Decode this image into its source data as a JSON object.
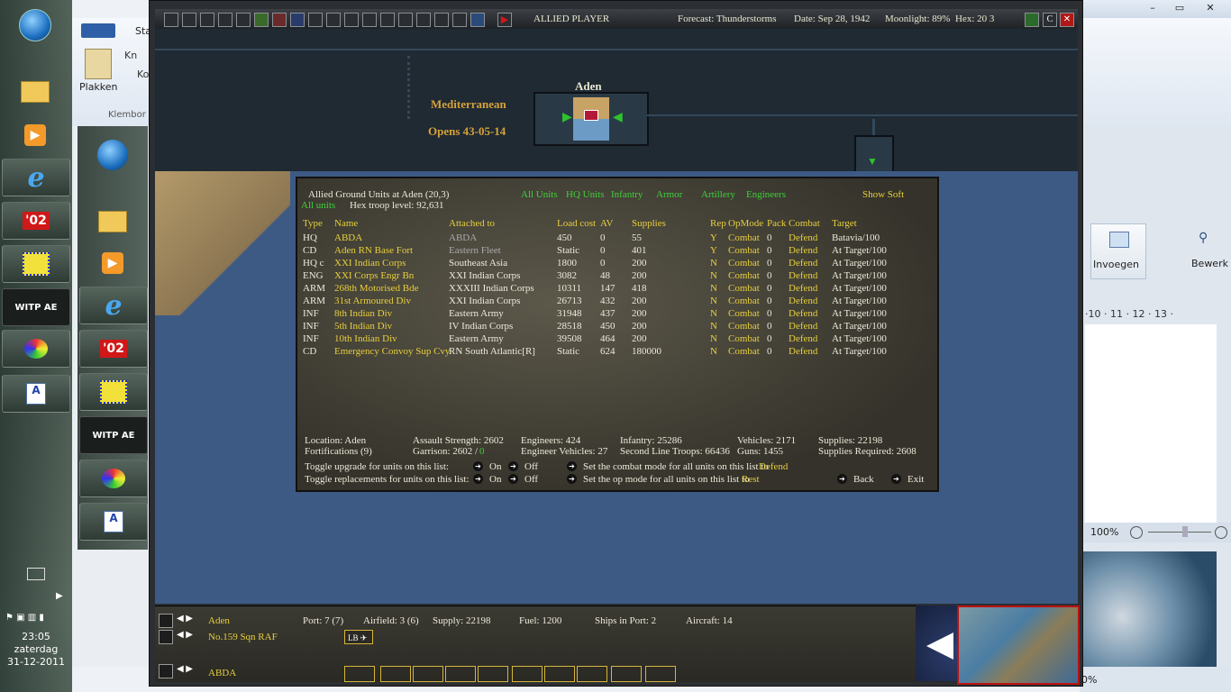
{
  "taskbar": {
    "time": "23:05",
    "day": "zaterdag",
    "date": "31-12-2011",
    "apps": [
      "start-orb",
      "folder",
      "media-player",
      "internet-explorer",
      "o2",
      "color-pen",
      "witp-ae",
      "paint",
      "wordpad"
    ],
    "witp_label": "WITP AE",
    "o2_label": "'02"
  },
  "word": {
    "clipboard_paste": "Plakken",
    "clipboard_group": "Klembor",
    "tab_partial": "Sta",
    "cut_partial": "Kn",
    "copy_partial": "Ko",
    "insert_label": "Invoegen",
    "edit_label": "Bewerk",
    "ruler": "·10 · 11 · 12 · 13 ·",
    "zoom": "100%",
    "zoom_bottom": "0%"
  },
  "game": {
    "player": "ALLIED PLAYER",
    "forecast": "Forecast: Thunderstorms",
    "date": "Date: Sep 28, 1942",
    "moonlight": "Moonlight: 89%",
    "hex": "Hex: 20 3",
    "map": {
      "base_name": "Aden",
      "mediterranean": "Mediterranean",
      "opens": "Opens 43-05-14"
    },
    "dialog": {
      "title": "Allied Ground Units at Aden  (20,3)",
      "all_units_label": "All units",
      "hex_troop": "Hex troop level: 92,631",
      "filters": [
        "All Units",
        "HQ Units",
        "Infantry",
        "Armor",
        "Artillery",
        "Engineers"
      ],
      "show_soft": "Show Soft",
      "columns": [
        "Type",
        "Name",
        "Attached to",
        "Load cost",
        "AV",
        "Supplies",
        "Rep",
        "OpMode",
        "Pack",
        "Combat",
        "Target"
      ],
      "rows": [
        [
          "HQ",
          "ABDA",
          "ABDA",
          "450",
          "0",
          "55",
          "Y",
          "Combat",
          "0",
          "Defend",
          "Batavia/100"
        ],
        [
          "CD",
          "Aden RN Base Fort",
          "Eastern Fleet",
          "Static",
          "0",
          "401",
          "Y",
          "Combat",
          "0",
          "Defend",
          "At Target/100"
        ],
        [
          "HQ c",
          "XXI Indian Corps",
          "Southeast Asia",
          "1800",
          "0",
          "200",
          "N",
          "Combat",
          "0",
          "Defend",
          "At Target/100"
        ],
        [
          "ENG",
          "XXI Corps Engr Bn",
          "XXI Indian Corps",
          "3082",
          "48",
          "200",
          "N",
          "Combat",
          "0",
          "Defend",
          "At Target/100"
        ],
        [
          "ARM",
          "268th Motorised Bde",
          "XXXIII Indian Corps",
          "10311",
          "147",
          "418",
          "N",
          "Combat",
          "0",
          "Defend",
          "At Target/100"
        ],
        [
          "ARM",
          "31st Armoured Div",
          "XXI Indian Corps",
          "26713",
          "432",
          "200",
          "N",
          "Combat",
          "0",
          "Defend",
          "At Target/100"
        ],
        [
          "INF",
          "8th Indian Div",
          "Eastern Army",
          "31948",
          "437",
          "200",
          "N",
          "Combat",
          "0",
          "Defend",
          "At Target/100"
        ],
        [
          "INF",
          "5th Indian Div",
          "IV Indian Corps",
          "28518",
          "450",
          "200",
          "N",
          "Combat",
          "0",
          "Defend",
          "At Target/100"
        ],
        [
          "INF",
          "10th Indian Div",
          "Eastern Army",
          "39508",
          "464",
          "200",
          "N",
          "Combat",
          "0",
          "Defend",
          "At Target/100"
        ],
        [
          "CD",
          "Emergency Convoy Sup Cvy",
          "RN South Atlantic[R]",
          "Static",
          "624",
          "180000",
          "N",
          "Combat",
          "0",
          "Defend",
          "At Target/100"
        ]
      ],
      "summary": {
        "location": "Location: Aden",
        "fortifications": "Fortifications (9)",
        "assault": "Assault Strength: 2602",
        "garrison": "Garrison: 2602 /",
        "garrison_extra": "0",
        "engineers": "Engineers: 424",
        "engineer_vehicles": "Engineer Vehicles: 27",
        "infantry": "Infantry: 25286",
        "second_line": "Second Line Troops: 66436",
        "vehicles": "Vehicles: 2171",
        "guns": "Guns: 1455",
        "supplies": "Supplies: 22198",
        "supplies_req": "Supplies Required: 2608"
      },
      "toggle_upgrade": "Toggle upgrade for units on this list:",
      "toggle_replacements": "Toggle replacements for units on this list:",
      "on": "On",
      "off": "Off",
      "set_combat": "Set the combat mode for all units on this list to",
      "combat_value": "Defend",
      "set_op": "Set the op mode for all units on this list to",
      "op_value": "Rest",
      "back": "Back",
      "exit": "Exit"
    },
    "bottom": {
      "base": "Aden",
      "squadron": "No.159 Sqn RAF",
      "hq": "ABDA",
      "port": "Port: 7 (7)",
      "airfield": "Airfield: 3 (6)",
      "supply": "Supply: 22198",
      "fuel": "Fuel: 1200",
      "ships": "Ships in Port: 2",
      "aircraft": "Aircraft: 14",
      "lb_label": "LB"
    }
  }
}
